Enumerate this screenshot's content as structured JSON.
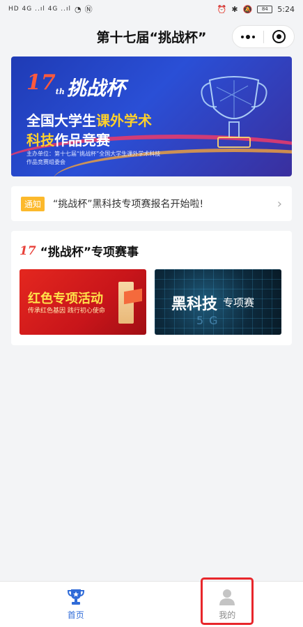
{
  "status_bar": {
    "left_indicators": "HD 4G ..ıl 4G ..ıl",
    "time": "5:24",
    "battery": "84"
  },
  "nav": {
    "title": "第十七届“挑战杯”"
  },
  "banner": {
    "logo_number": "17",
    "logo_suffix": "th",
    "brand": "挑战杯",
    "line1_prefix": "全国大学生",
    "line1_highlight": "课外学术",
    "line2_highlight": "科技",
    "line2_suffix": "作品竞赛",
    "organizer": "主办单位：第十七届“挑战杯”全国大学生课外学术科技作品竞赛组委会"
  },
  "notice": {
    "tag": "通知",
    "text": "“挑战杯”黑科技专项赛报名开始啦!"
  },
  "section": {
    "logo": "17",
    "title": "“挑战杯”专项赛事",
    "cards": [
      {
        "title": "红色专项活动",
        "subtitle": "传承红色基因 践行初心使命"
      },
      {
        "title": "黑科技",
        "title_suffix": "专项赛",
        "overlay": "5G"
      }
    ]
  },
  "tabbar": {
    "tabs": [
      {
        "label": "首页",
        "icon": "trophy-icon",
        "active": true
      },
      {
        "label": "我的",
        "icon": "user-icon",
        "active": false
      }
    ]
  },
  "colors": {
    "accent": "#2f6bd8",
    "notice_tag": "#fcb92c",
    "highlight_box": "#e8262b"
  }
}
